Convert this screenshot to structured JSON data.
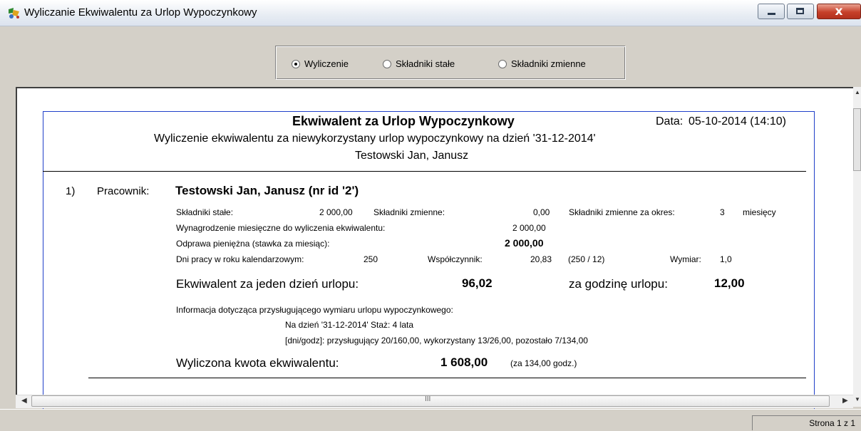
{
  "window": {
    "title": "Wyliczanie Ekwiwalentu za Urlop Wypoczynkowy",
    "icon": "app-icon",
    "min_label": "",
    "close_label": "x"
  },
  "view_options": [
    {
      "label": "Wyliczenie",
      "selected": true
    },
    {
      "label": "Składniki stałe",
      "selected": false
    },
    {
      "label": "Składniki zmienne",
      "selected": false
    }
  ],
  "report": {
    "title": "Ekwiwalent za Urlop Wypoczynkowy",
    "date_label": "Data:",
    "date_value": "05-10-2014 (14:10)",
    "subtitle": "Wyliczenie ekwiwalentu za niewykorzystany urlop wypoczynkowy na dzień '31-12-2014'",
    "person_name": "Testowski Jan, Janusz",
    "entry": {
      "index": "1)",
      "employee_label": "Pracownik:",
      "employee_value": "Testowski Jan, Janusz (nr id '2')",
      "fixed_label": "Składniki stałe:",
      "fixed_value": "2 000,00",
      "variable_label": "Składniki zmienne:",
      "variable_value": "0,00",
      "variable_period_label": "Składniki zmienne za okres:",
      "variable_period_value": "3",
      "variable_period_unit": "miesięcy",
      "monthly_label": "Wynagrodzenie miesięczne do wyliczenia ekwiwalentu:",
      "monthly_value": "2 000,00",
      "severance_label": "Odprawa pieniężna (stawka za miesiąc):",
      "severance_value": "2 000,00",
      "workdays_label": "Dni pracy w roku kalendarzowym:",
      "workdays_value": "250",
      "coef_label": "Współczynnik:",
      "coef_value": "20,83",
      "coef_formula": "(250 / 12)",
      "dimension_label": "Wymiar:",
      "dimension_value": "1,0",
      "day_equiv_label": "Ekwiwalent za jeden dzień urlopu:",
      "day_equiv_value": "96,02",
      "hour_equiv_label": "za godzinę urlopu:",
      "hour_equiv_value": "12,00",
      "info_label": "Informacja dotycząca przysługującego wymiaru urlopu wypoczynkowego:",
      "info_line1": "Na dzień '31-12-2014' Staż: 4 lata",
      "info_line2": "[dni/godz]: przysługujący 20/160,00, wykorzystany 13/26,00, pozostało 7/134,00",
      "total_label": "Wyliczona kwota ekwiwalentu:",
      "total_value": "1 608,00",
      "total_note": "(za 134,00 godz.)"
    }
  },
  "scroll": {
    "grip": "III"
  },
  "status": {
    "page": "Strona 1 z 1"
  }
}
